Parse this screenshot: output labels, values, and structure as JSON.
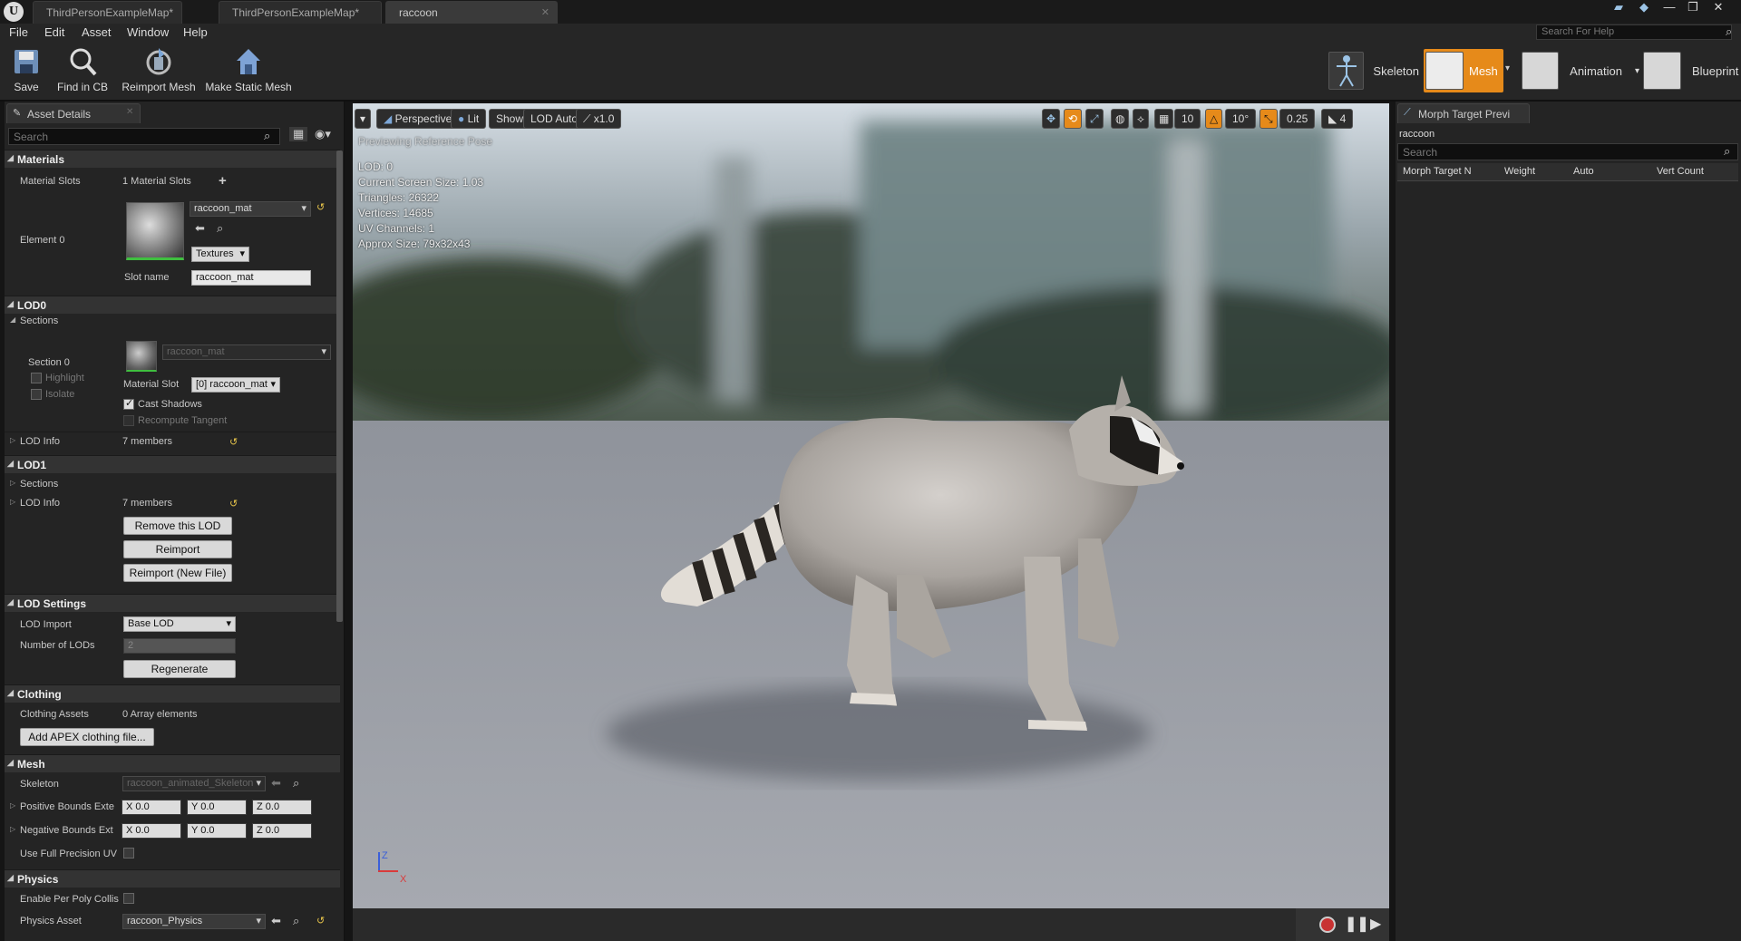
{
  "tabs": [
    {
      "label": "ThirdPersonExampleMap*",
      "active": false
    },
    {
      "label": "ThirdPersonExampleMap*",
      "active": false
    },
    {
      "label": "raccoon",
      "active": true
    }
  ],
  "menu": [
    "File",
    "Edit",
    "Asset",
    "Window",
    "Help"
  ],
  "help_search_placeholder": "Search For Help",
  "toolbar": {
    "save": "Save",
    "find_in_cb": "Find in CB",
    "reimport_mesh": "Reimport Mesh",
    "make_static_mesh": "Make Static Mesh"
  },
  "modes": {
    "skeleton": "Skeleton",
    "mesh": "Mesh",
    "animation": "Animation",
    "blueprint": "Blueprint",
    "active_color": "#e68a1a"
  },
  "asset_details": {
    "tab": "Asset Details",
    "search_placeholder": "Search",
    "materials": {
      "header": "Materials",
      "slots_label": "Material Slots",
      "slots_value": "1 Material Slots",
      "element_label": "Element 0",
      "material": "raccoon_mat",
      "textures": "Textures",
      "slot_name_label": "Slot name",
      "slot_name_value": "raccoon_mat"
    },
    "lod0": {
      "header": "LOD0",
      "sections": "Sections",
      "section0": "Section 0",
      "highlight": "Highlight",
      "isolate": "Isolate",
      "material": "raccoon_mat",
      "material_slot_label": "Material Slot",
      "material_slot_value": "[0] raccoon_mat",
      "cast_shadows": "Cast Shadows",
      "recompute_tangent": "Recompute Tangent",
      "lod_info": "LOD Info",
      "lod_info_value": "7 members"
    },
    "lod1": {
      "header": "LOD1",
      "sections": "Sections",
      "lod_info": "LOD Info",
      "lod_info_value": "7 members",
      "remove": "Remove this LOD",
      "reimport": "Reimport",
      "reimport_new": "Reimport (New File)"
    },
    "lod_settings": {
      "header": "LOD Settings",
      "lod_import_label": "LOD Import",
      "lod_import_value": "Base LOD",
      "num_lods_label": "Number of LODs",
      "num_lods_value": "2",
      "regenerate": "Regenerate"
    },
    "clothing": {
      "header": "Clothing",
      "assets_label": "Clothing Assets",
      "assets_value": "0 Array elements",
      "add_button": "Add APEX clothing file..."
    },
    "mesh": {
      "header": "Mesh",
      "skeleton_label": "Skeleton",
      "skeleton_value": "raccoon_animated_Skeleton",
      "pos_bounds_label": "Positive Bounds Exte",
      "neg_bounds_label": "Negative Bounds Ext",
      "x_label": "X",
      "x_value": "0.0",
      "y_label": "Y",
      "y_value": "0.0",
      "z_label": "Z",
      "z_value": "0.0",
      "full_precision_label": "Use Full Precision UV"
    },
    "physics": {
      "header": "Physics",
      "per_poly_label": "Enable Per Poly Collis",
      "asset_label": "Physics Asset",
      "asset_value": "raccoon_Physics"
    }
  },
  "viewport": {
    "perspective": "Perspective",
    "lit": "Lit",
    "show": "Show",
    "lod_auto": "LOD Auto",
    "speed": "x1.0",
    "grid_snap": "10",
    "rot_snap": "10°",
    "scale_snap": "0.25",
    "cam_speed": "4",
    "preview_label": "Previewing Reference Pose",
    "info": {
      "lod": "LOD: 0",
      "screen_size": "Current Screen Size: 1.03",
      "triangles": "Triangles: 26322",
      "vertices": "Vertices: 14685",
      "uv_channels": "UV Channels: 1",
      "approx_size": "Approx Size: 79x32x43"
    },
    "axis_z": "Z",
    "axis_x": "X"
  },
  "morph_panel": {
    "tab": "Morph Target Previ",
    "asset": "raccoon",
    "search_placeholder": "Search",
    "col_name": "Morph Target N",
    "col_weight": "Weight",
    "col_auto": "Auto",
    "col_vert": "Vert Count"
  }
}
